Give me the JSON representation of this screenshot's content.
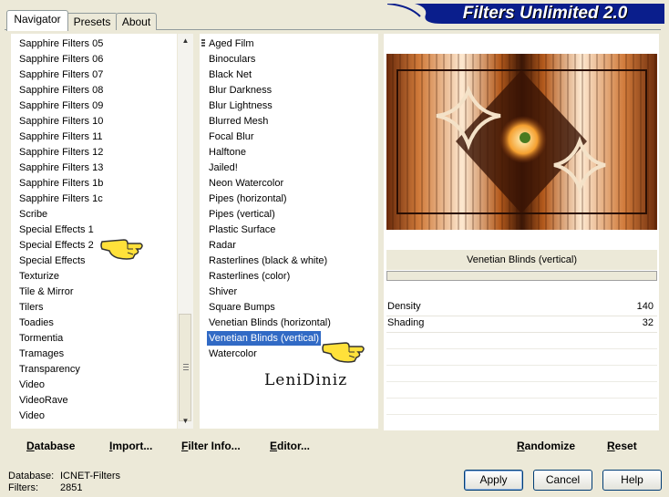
{
  "tabs": [
    "Navigator",
    "Presets",
    "About"
  ],
  "banner": "Filters Unlimited 2.0",
  "categories": [
    "Sapphire Filters 05",
    "Sapphire Filters 06",
    "Sapphire Filters 07",
    "Sapphire Filters 08",
    "Sapphire Filters 09",
    "Sapphire Filters 10",
    "Sapphire Filters 11",
    "Sapphire Filters 12",
    "Sapphire Filters 13",
    "Sapphire Filters 1b",
    "Sapphire Filters 1c",
    "Scribe",
    "Special Effects 1",
    "Special Effects 2",
    "Special Effects",
    "Texturize",
    "Tile & Mirror",
    "Tilers",
    "Toadies",
    "Tormentia",
    "Tramages",
    "Transparency",
    "Video",
    "VideoRave",
    "Video"
  ],
  "filters": [
    "Aged Film",
    "Binoculars",
    "Black Net",
    "Blur Darkness",
    "Blur Lightness",
    "Blurred Mesh",
    "Focal Blur",
    "Halftone",
    "Jailed!",
    "Neon Watercolor",
    "Pipes (horizontal)",
    "Pipes (vertical)",
    "Plastic Surface",
    "Radar",
    "Rasterlines (black & white)",
    "Rasterlines (color)",
    "Shiver",
    "Square Bumps",
    "Venetian Blinds (horizontal)",
    "Venetian Blinds (vertical)",
    "Watercolor"
  ],
  "selected_filter": "Venetian Blinds (vertical)",
  "preview_filter_name": "Venetian Blinds (vertical)",
  "params": [
    {
      "label": "Density",
      "value": "140"
    },
    {
      "label": "Shading",
      "value": "32"
    }
  ],
  "signature": "LeniDiniz",
  "toolbar": {
    "database": "Database",
    "import": "Import...",
    "filter_info": "Filter Info...",
    "editor": "Editor...",
    "randomize": "Randomize",
    "reset": "Reset"
  },
  "status": {
    "database_label": "Database:",
    "database_value": "ICNET-Filters",
    "filters_label": "Filters:",
    "filters_value": "2851"
  },
  "buttons": {
    "apply": "Apply",
    "cancel": "Cancel",
    "help": "Help"
  },
  "colors": {
    "selection": "#316ac5",
    "banner": "#0a1e8c"
  }
}
